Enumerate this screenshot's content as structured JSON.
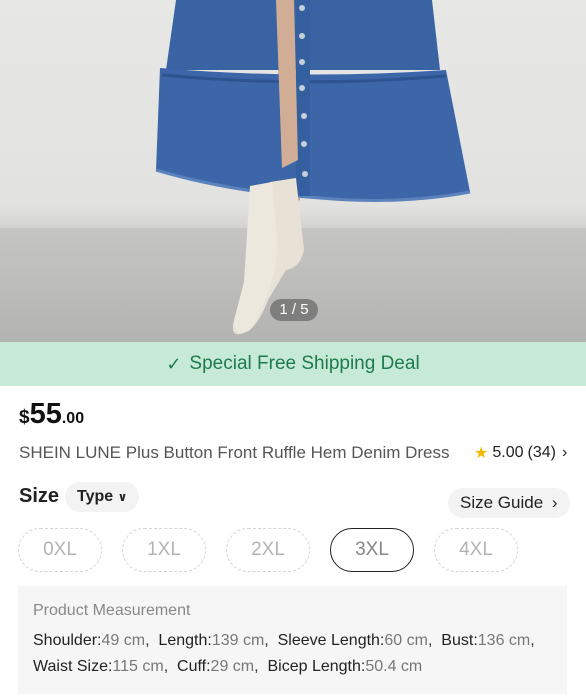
{
  "gallery": {
    "counter": "1 / 5"
  },
  "shipping_banner": {
    "text": "Special Free Shipping Deal"
  },
  "price": {
    "currency": "$",
    "whole": "55",
    "cents": ".00"
  },
  "product": {
    "title": "SHEIN LUNE Plus Button Front Ruffle Hem Denim Dress",
    "rating": "5.00",
    "reviews": "(34)"
  },
  "size": {
    "label": "Size",
    "type_label": "Type",
    "guide_label": "Size Guide",
    "options": [
      {
        "label": "0XL",
        "selected": false
      },
      {
        "label": "1XL",
        "selected": false
      },
      {
        "label": "2XL",
        "selected": false
      },
      {
        "label": "3XL",
        "selected": true
      },
      {
        "label": "4XL",
        "selected": false
      }
    ]
  },
  "measurement": {
    "heading": "Product Measurement",
    "items": [
      {
        "key": "Shoulder:",
        "value": "49 cm"
      },
      {
        "key": "Length:",
        "value": "139 cm"
      },
      {
        "key": "Sleeve Length:",
        "value": "60 cm"
      },
      {
        "key": "Bust:",
        "value": "136 cm"
      },
      {
        "key": "Waist Size:",
        "value": "115 cm"
      },
      {
        "key": "Cuff:",
        "value": "29 cm"
      },
      {
        "key": "Bicep Length:",
        "value": "50.4 cm"
      }
    ]
  },
  "colors": {
    "banner_bg": "#c6ead7",
    "banner_text": "#1f7a4c",
    "star": "#f5b800",
    "denim": "#3b64a3"
  }
}
